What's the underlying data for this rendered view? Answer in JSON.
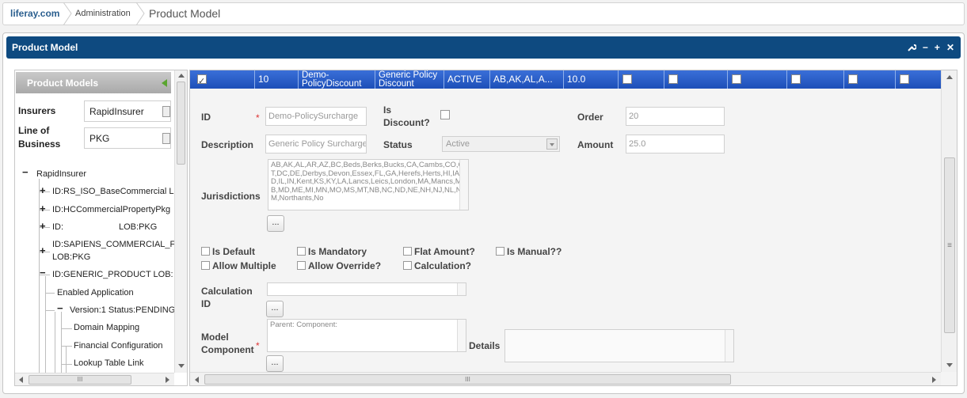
{
  "breadcrumb": {
    "home": "liferay.com",
    "admin": "Administration",
    "current": "Product Model"
  },
  "portlet": {
    "title": "Product Model",
    "controls": [
      "wrench-icon",
      "minimize-icon",
      "maximize-icon",
      "close-icon"
    ]
  },
  "left_panel": {
    "header": "Product Models",
    "insurers_label": "Insurers",
    "insurers_value": "RapidInsurer",
    "lob_label_1": "Line of",
    "lob_label_2": "Business",
    "lob_value": "PKG",
    "tree": {
      "root": "RapidInsurer",
      "n1": "ID:RS_ISO_BaseCommercial L",
      "n2": "ID:HCCommercialPropertyPkg",
      "n3a": "ID:",
      "n3b": "LOB:PKG",
      "n4a": "ID:SAPIENS_COMMERCIAL_F",
      "n4b": "LOB:PKG",
      "n5": "ID:GENERIC_PRODUCT LOB:",
      "n6": "Enabled Application",
      "n7": "Version:1 Status:PENDING",
      "n8": "Domain Mapping",
      "n9": "Financial Configuration",
      "n10": "Lookup Table Link"
    }
  },
  "grid_row": {
    "order": "10",
    "id_1": "Demo-",
    "id_2": "PolicyDiscount",
    "desc_1": "Generic Policy",
    "desc_2": "Discount",
    "status": "ACTIVE",
    "jurisdictions": "AB,AK,AL,A...",
    "amount": "10.0"
  },
  "form": {
    "id_label": "ID",
    "id_value": "Demo-PolicySurcharge",
    "is_discount_label_1": "Is",
    "is_discount_label_2": "Discount?",
    "order_label": "Order",
    "order_value": "20",
    "description_label": "Description",
    "description_value": "Generic Policy Surcharge",
    "status_label": "Status",
    "status_value": "Active",
    "amount_label": "Amount",
    "amount_value": "25.0",
    "jurisdictions_label": "Jurisdictions",
    "jurisdictions_value": "AB,AK,AL,AR,AZ,BC,Beds,Berks,Bucks,CA,Cambs,CO,CT,DC,DE,Derbys,Devon,Essex,FL,GA,Herefs,Herts,HI,IA,ID,IL,IN,Kent,KS,KY,LA,Lancs,Leics,London,MA,Mancs,MB,MD,ME,MI,MN,MO,MS,MT,NB,NC,ND,NE,NH,NJ,NL,NM,Northants,No",
    "ellipsis": "...",
    "is_default": "Is Default",
    "is_mandatory": "Is Mandatory",
    "flat_amount": "Flat Amount?",
    "is_manual": "Is Manual??",
    "allow_multiple": "Allow Multiple",
    "allow_override": "Allow Override?",
    "calculation": "Calculation?",
    "calc_id_label_1": "Calculation",
    "calc_id_label_2": "ID",
    "model_component_label_1": "Model",
    "model_component_label_2": "Component",
    "model_component_placeholder": "Parent: Component:",
    "details_label": "Details",
    "required_mark": "*"
  },
  "scroll": {
    "left_glyph": "III",
    "right_glyph": "III",
    "v_glyph": "≡"
  }
}
